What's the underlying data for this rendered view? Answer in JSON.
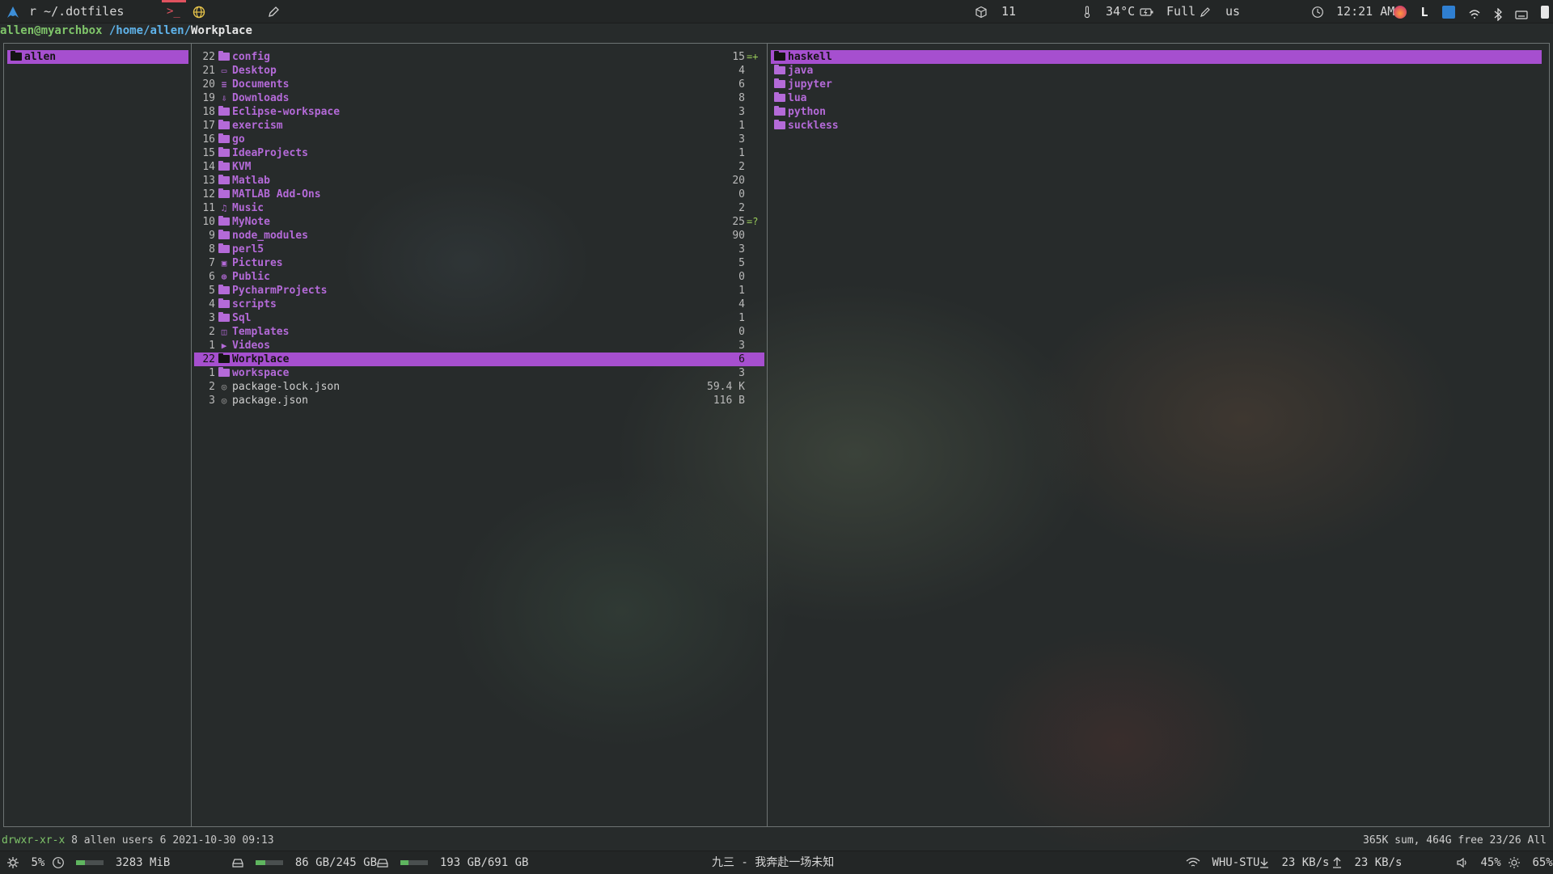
{
  "topbar": {
    "window_title": "r ~/.dotfiles",
    "workspace_count": "11",
    "temperature": "34°C",
    "battery": "Full",
    "keyboard_layout": "us",
    "clock": "12:21 AM"
  },
  "ranger": {
    "path_user": "allen@myarchbox",
    "path_dir": "/home/allen/",
    "path_current": "Workplace",
    "parent_column": [
      {
        "name": "allen",
        "selected": true
      }
    ],
    "main_column": [
      {
        "num": "22",
        "name": "config",
        "count": "15",
        "flag": "=+",
        "icon": "folder"
      },
      {
        "num": "21",
        "name": "Desktop",
        "count": "4",
        "icon": "desktop"
      },
      {
        "num": "20",
        "name": "Documents",
        "count": "6",
        "icon": "document"
      },
      {
        "num": "19",
        "name": "Downloads",
        "count": "8",
        "icon": "download"
      },
      {
        "num": "18",
        "name": "Eclipse-workspace",
        "count": "3",
        "icon": "folder"
      },
      {
        "num": "17",
        "name": "exercism",
        "count": "1",
        "icon": "folder"
      },
      {
        "num": "16",
        "name": "go",
        "count": "3",
        "icon": "folder"
      },
      {
        "num": "15",
        "name": "IdeaProjects",
        "count": "1",
        "icon": "folder"
      },
      {
        "num": "14",
        "name": "KVM",
        "count": "2",
        "icon": "folder"
      },
      {
        "num": "13",
        "name": "Matlab",
        "count": "20",
        "icon": "folder"
      },
      {
        "num": "12",
        "name": "MATLAB Add-Ons",
        "count": "0",
        "icon": "folder"
      },
      {
        "num": "11",
        "name": "Music",
        "count": "2",
        "icon": "music"
      },
      {
        "num": "10",
        "name": "MyNote",
        "count": "25",
        "flag": "=?",
        "icon": "folder"
      },
      {
        "num": "9",
        "name": "node_modules",
        "count": "90",
        "icon": "folder"
      },
      {
        "num": "8",
        "name": "perl5",
        "count": "3",
        "icon": "folder"
      },
      {
        "num": "7",
        "name": "Pictures",
        "count": "5",
        "icon": "picture"
      },
      {
        "num": "6",
        "name": "Public",
        "count": "0",
        "icon": "public"
      },
      {
        "num": "5",
        "name": "PycharmProjects",
        "count": "1",
        "icon": "folder"
      },
      {
        "num": "4",
        "name": "scripts",
        "count": "4",
        "icon": "folder"
      },
      {
        "num": "3",
        "name": "Sql",
        "count": "1",
        "icon": "folder"
      },
      {
        "num": "2",
        "name": "Templates",
        "count": "0",
        "icon": "template"
      },
      {
        "num": "1",
        "name": "Videos",
        "count": "3",
        "icon": "video"
      },
      {
        "num": "22",
        "name": "Workplace",
        "count": "6",
        "icon": "folder",
        "selected": true
      },
      {
        "num": "1",
        "name": "workspace",
        "count": "3",
        "icon": "folder"
      },
      {
        "num": "2",
        "name": "package-lock.json",
        "count": "59.4 K",
        "icon": "file"
      },
      {
        "num": "3",
        "name": "package.json",
        "count": "116 B",
        "icon": "file"
      }
    ],
    "preview_column": [
      {
        "name": "haskell",
        "selected": true
      },
      {
        "name": "java"
      },
      {
        "name": "jupyter"
      },
      {
        "name": "lua"
      },
      {
        "name": "python"
      },
      {
        "name": "suckless"
      }
    ],
    "status_left": "drwxr-xr-x 8 allen users 6 2021-10-30 09:13",
    "status_right": "365K sum, 464G free  23/26  All"
  },
  "bottombar": {
    "cpu": "5%",
    "memory": "3283 MiB",
    "memory_fraction": 0.3,
    "disk_root": "86 GB/245 GB",
    "disk_root_fraction": 0.35,
    "disk_home": "193 GB/691 GB",
    "disk_home_fraction": 0.28,
    "now_playing": "九三 - 我奔赴一场未知",
    "wifi": "WHU-STU",
    "download_speed": "23 KB/s",
    "upload_speed": "23 KB/s",
    "volume": "45%",
    "brightness": "65%"
  },
  "colors": {
    "selection": "#a64fcf",
    "directory": "#b46ad8",
    "path_user": "#7fc56a",
    "path_dir": "#5fb3ea"
  }
}
